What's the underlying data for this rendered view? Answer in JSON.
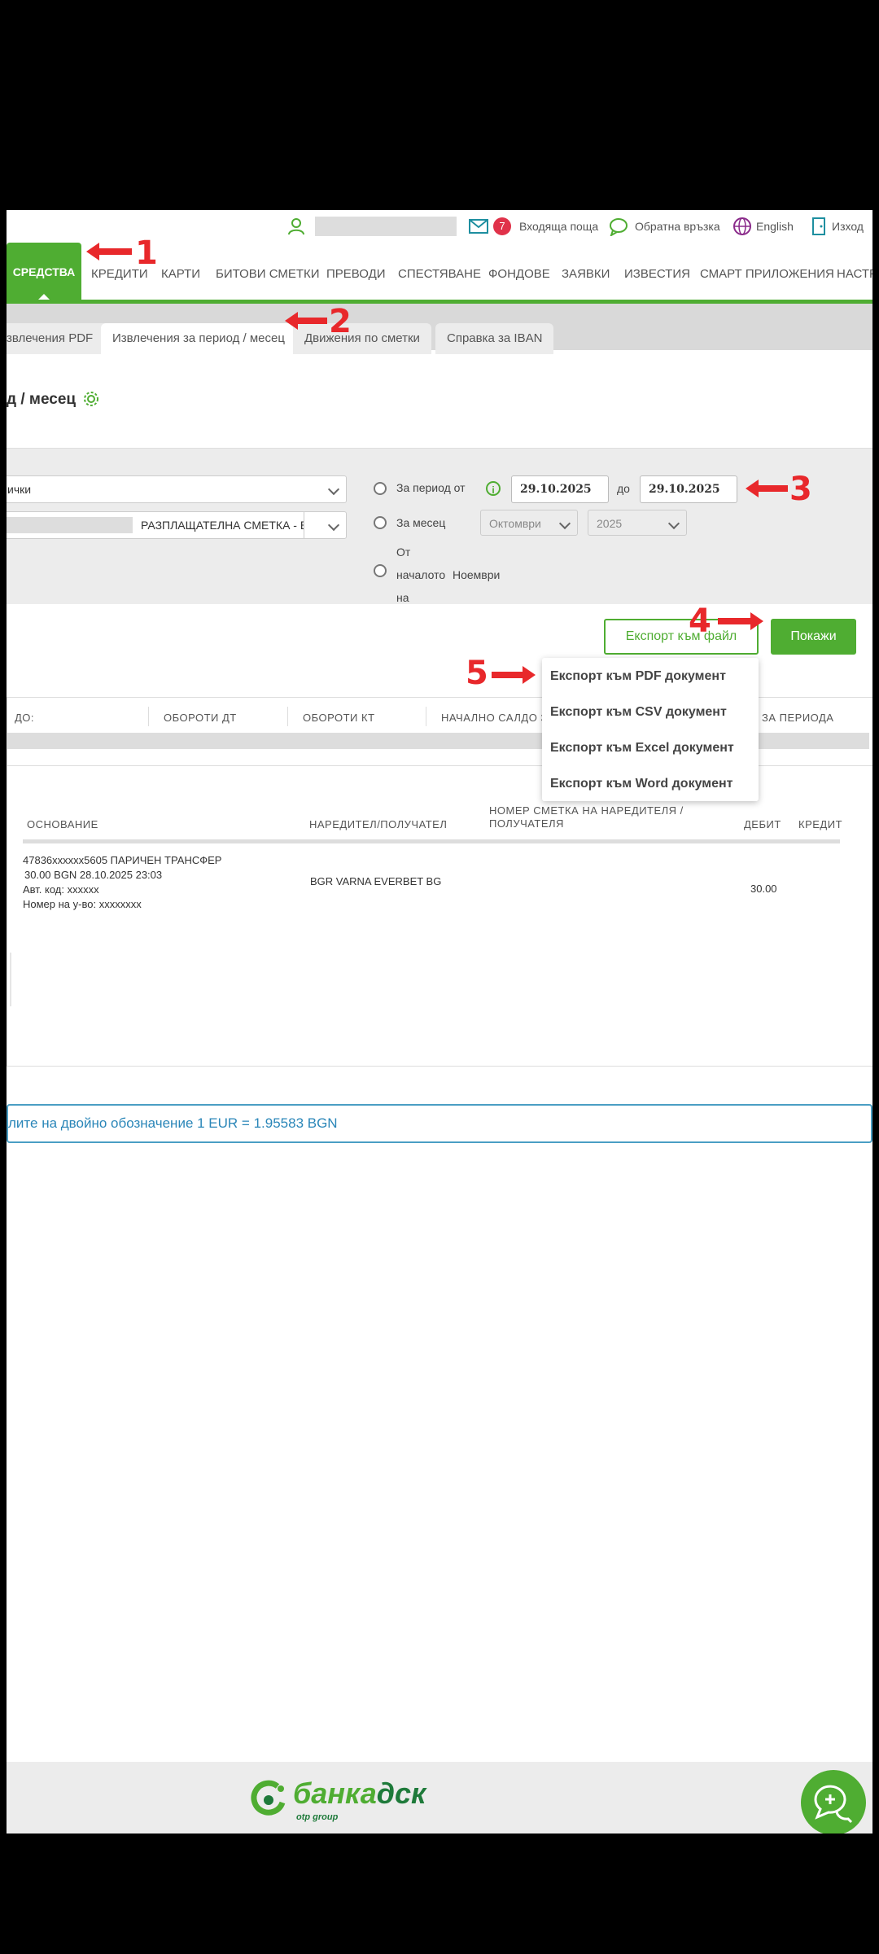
{
  "topbar": {
    "inbox_count": "7",
    "inbox_label": "Входяща поща",
    "feedback_label": "Обратна връзка",
    "language_label": "English",
    "logout_label": "Изход"
  },
  "nav": {
    "active": "СРЕДСТВА",
    "items": [
      "КРЕДИТИ",
      "КАРТИ",
      "БИТОВИ СМЕТКИ",
      "ПРЕВОДИ",
      "СПЕСТЯВАНЕ",
      "ФОНДОВЕ",
      "ЗАЯВКИ",
      "ИЗВЕСТИЯ",
      "СМАРТ ПРИЛОЖЕНИЯ",
      "НАСТР"
    ]
  },
  "tabs": [
    "звлечения PDF",
    "Извлечения за период / месец",
    "Движения по сметки",
    "Справка за IBAN"
  ],
  "page_title": "д / месец",
  "filters": {
    "account_type": "ички",
    "account": "РАЗПЛАЩАТЕЛНА СМЕТКА - BG",
    "period_label": "За период от",
    "date_from": "29.10.2025",
    "to_label": "до",
    "date_to": "29.10.2025",
    "month_label": "За месец",
    "month_value": "Октомври",
    "year_value": "2025",
    "start_label": [
      "От",
      "началото",
      "на"
    ],
    "start_month": "Ноември"
  },
  "actions": {
    "export_label": "Експорт към файл",
    "show_label": "Покажи",
    "export_options": [
      "Експорт към PDF документ",
      "Експорт към CSV документ",
      "Експорт към Excel документ",
      "Експорт към Word документ"
    ]
  },
  "summary": {
    "headers": [
      "ДО:",
      "ОБОРОТИ ДТ",
      "ОБОРОТИ КТ",
      "НАЧАЛНО САЛДО З",
      "ЗА ПЕРИОДА"
    ]
  },
  "transactions": {
    "headers": {
      "basis": "ОСНОВАНИЕ",
      "party": "НАРЕДИТЕЛ/ПОЛУЧАТЕЛ",
      "account_line1": "НОМЕР СМЕТКА НА НАРЕДИТЕЛЯ /",
      "account_line2": "ПОЛУЧАТЕЛЯ",
      "debit": "ДЕБИТ",
      "credit": "КРЕДИТ"
    },
    "rows": [
      {
        "basis": [
          "47836xxxxxx5605 ПАРИЧЕН ТРАНСФЕР",
          "30.00 BGN 28.10.2025 23:03",
          "Авт. код: xxxxxx",
          "Номер на у-во: xxxxxxxx"
        ],
        "party": "BGR VARNA EVERBET BG",
        "debit": "30.00"
      }
    ]
  },
  "notice": "лите на двойно обозначение 1 EUR = 1.95583 BGN",
  "footer": {
    "logo_main": "банка",
    "logo_accent": "дск",
    "logo_sub": "otp group"
  },
  "annotations": [
    "1",
    "2",
    "3",
    "4",
    "5"
  ],
  "colors": {
    "brand_green": "#4fad32",
    "annotation_red": "#e8282b",
    "notice_blue": "#2a86b8"
  }
}
